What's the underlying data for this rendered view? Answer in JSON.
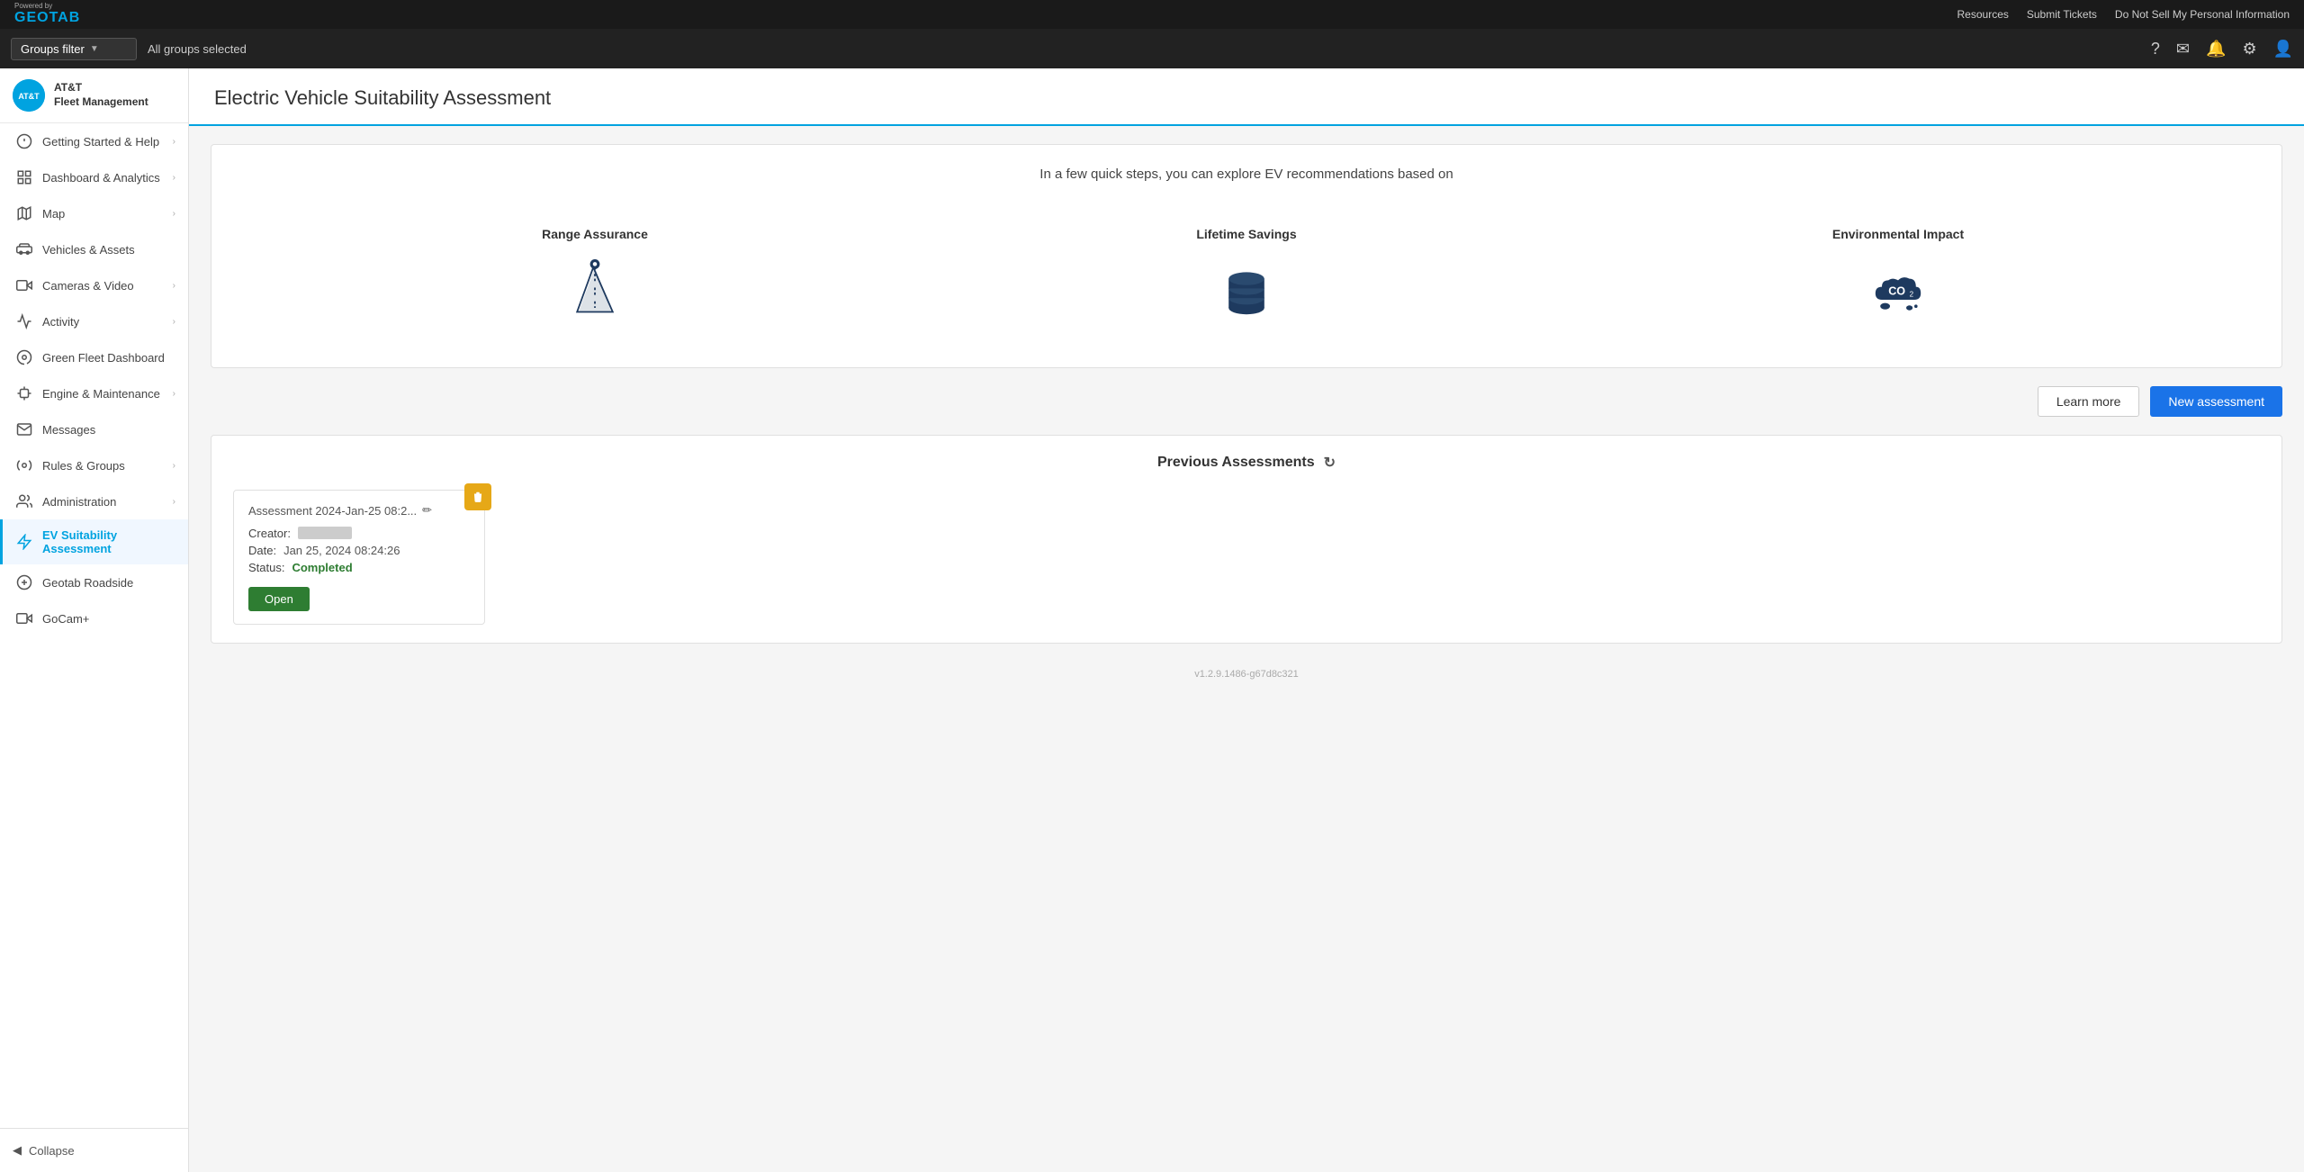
{
  "topbar": {
    "powered_by": "Powered by",
    "brand": "GEOTAB",
    "resources": "Resources",
    "submit_tickets": "Submit Tickets",
    "do_not_sell": "Do Not Sell My Personal Information"
  },
  "subheader": {
    "groups_filter_label": "Groups filter",
    "all_groups_selected": "All groups selected"
  },
  "sidebar": {
    "brand_name": "AT&T\nFleet Management",
    "brand_initials": "AT&T",
    "collapse_label": "Collapse",
    "items": [
      {
        "id": "getting-started",
        "label": "Getting Started & Help",
        "has_chevron": true,
        "icon": "question-circle"
      },
      {
        "id": "dashboard-analytics",
        "label": "Dashboard & Analytics",
        "has_chevron": true,
        "icon": "chart-bar"
      },
      {
        "id": "map",
        "label": "Map",
        "has_chevron": true,
        "icon": "map"
      },
      {
        "id": "vehicles-assets",
        "label": "Vehicles & Assets",
        "has_chevron": false,
        "icon": "truck"
      },
      {
        "id": "cameras-video",
        "label": "Cameras & Video",
        "has_chevron": true,
        "icon": "camera"
      },
      {
        "id": "activity",
        "label": "Activity",
        "has_chevron": true,
        "icon": "activity"
      },
      {
        "id": "green-fleet",
        "label": "Green Fleet Dashboard",
        "has_chevron": false,
        "icon": "leaf"
      },
      {
        "id": "engine-maintenance",
        "label": "Engine & Maintenance",
        "has_chevron": true,
        "icon": "wrench"
      },
      {
        "id": "messages",
        "label": "Messages",
        "has_chevron": false,
        "icon": "envelope"
      },
      {
        "id": "rules-groups",
        "label": "Rules & Groups",
        "has_chevron": true,
        "icon": "rules"
      },
      {
        "id": "administration",
        "label": "Administration",
        "has_chevron": true,
        "icon": "admin"
      },
      {
        "id": "ev-suitability",
        "label": "EV Suitability Assessment",
        "has_chevron": false,
        "icon": "ev",
        "active": true
      },
      {
        "id": "geotab-roadside",
        "label": "Geotab Roadside",
        "has_chevron": false,
        "icon": "roadside"
      },
      {
        "id": "gocam",
        "label": "GoCam+",
        "has_chevron": false,
        "icon": "gocam"
      }
    ]
  },
  "page": {
    "title": "Electric Vehicle Suitability Assessment",
    "intro": "In a few quick steps, you can explore EV recommendations based on",
    "features": [
      {
        "id": "range",
        "label": "Range Assurance",
        "icon": "road"
      },
      {
        "id": "savings",
        "label": "Lifetime Savings",
        "icon": "savings"
      },
      {
        "id": "env",
        "label": "Environmental Impact",
        "icon": "co2"
      }
    ],
    "learn_more_label": "Learn more",
    "new_assessment_label": "New assessment",
    "previous_assessments_label": "Previous Assessments",
    "assessment": {
      "title": "Assessment 2024-Jan-25 08:2...",
      "creator_label": "Creator:",
      "date_label": "Date:",
      "date_value": "Jan 25, 2024 08:24:26",
      "status_label": "Status:",
      "status_value": "Completed",
      "open_label": "Open"
    },
    "version": "v1.2.9.1486-g67d8c321"
  }
}
